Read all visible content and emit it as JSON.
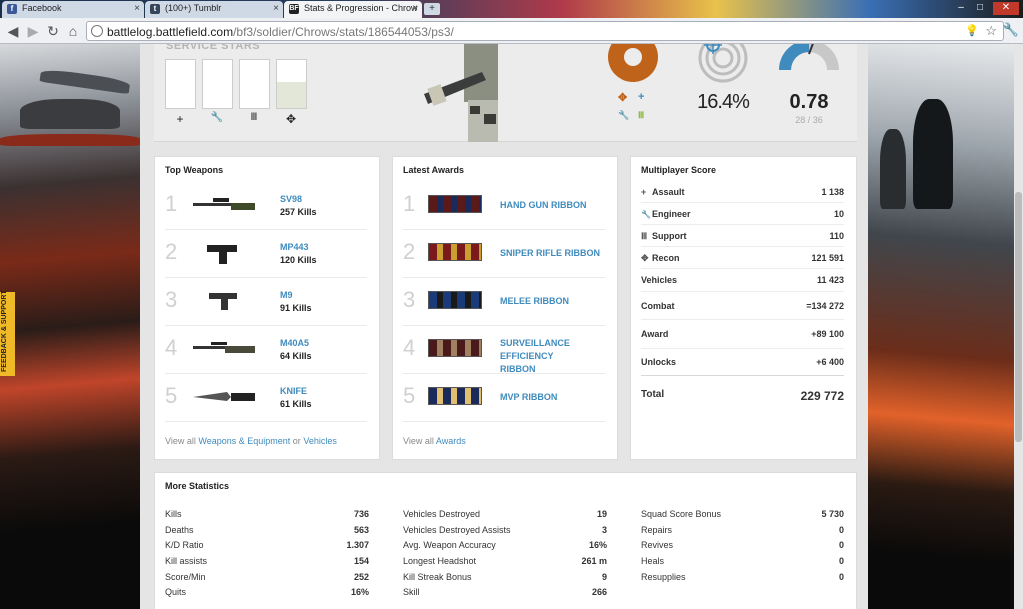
{
  "browser": {
    "tabs": [
      {
        "label": "Facebook",
        "favicon_color": "#3b5998"
      },
      {
        "label": "(100+) Tumblr",
        "favicon_color": "#35465c"
      },
      {
        "label": "Stats & Progression - Chrow",
        "favicon_color": "#222222"
      }
    ],
    "new_tab_label": "+",
    "url_host": "battlelog.battlefield.com",
    "url_path": "/bf3/soldier/Chrows/stats/186544053/ps3/"
  },
  "sidebar": {
    "feedback_label": "FEEDBACK & SUPPORT"
  },
  "service_stars": {
    "title": "SERVICE STARS",
    "icons": [
      "+",
      "🔧",
      "Ⅲ",
      "✥"
    ],
    "fill": [
      0,
      0,
      0,
      0.55
    ]
  },
  "summary": {
    "kit_icons": [
      "✥",
      "+",
      "🔧",
      "Ⅲ"
    ],
    "kit_colors": [
      "#c0631a",
      "#3f8bbd",
      "#e0a020",
      "#8ab93a"
    ],
    "accuracy": "16.4%",
    "kd": "0.78",
    "kd_sub": "28 / 36"
  },
  "top_weapons": {
    "title": "Top Weapons",
    "items": [
      {
        "rank": "1",
        "name": "SV98",
        "kills": "257 Kills"
      },
      {
        "rank": "2",
        "name": "MP443",
        "kills": "120 Kills"
      },
      {
        "rank": "3",
        "name": "M9",
        "kills": "91 Kills"
      },
      {
        "rank": "4",
        "name": "M40A5",
        "kills": "64 Kills"
      },
      {
        "rank": "5",
        "name": "KNIFE",
        "kills": "61 Kills"
      }
    ],
    "footer_prefix": "View all",
    "footer_link1": "Weapons & Equipment",
    "footer_mid": "or",
    "footer_link2": "Vehicles"
  },
  "latest_awards": {
    "title": "Latest Awards",
    "items": [
      {
        "rank": "1",
        "name": "HAND GUN RIBBON",
        "colors": [
          "#5a1a1a",
          "#1a2a5a"
        ]
      },
      {
        "rank": "2",
        "name": "SNIPER RIFLE RIBBON",
        "colors": [
          "#7a1a1a",
          "#c9a030"
        ]
      },
      {
        "rank": "3",
        "name": "MELEE RIBBON",
        "colors": [
          "#1a3a7a",
          "#1a1a1a"
        ]
      },
      {
        "rank": "4",
        "name": "SURVEILLANCE EFFICIENCY RIBBON",
        "colors": [
          "#4a1a1a",
          "#a08060"
        ]
      },
      {
        "rank": "5",
        "name": "MVP RIBBON",
        "colors": [
          "#1a2a5a",
          "#e0c070"
        ]
      }
    ],
    "footer_prefix": "View all",
    "footer_link": "Awards"
  },
  "multiplayer_score": {
    "title": "Multiplayer Score",
    "rows": [
      {
        "label": "Assault",
        "icon": "+",
        "value": "1 138"
      },
      {
        "label": "Engineer",
        "icon": "🔧",
        "value": "10"
      },
      {
        "label": "Support",
        "icon": "Ⅲ",
        "value": "110"
      },
      {
        "label": "Recon",
        "icon": "✥",
        "value": "121 591"
      },
      {
        "label": "Vehicles",
        "icon": "",
        "value": "11 423"
      },
      {
        "label": "Combat",
        "icon": "",
        "value": "=134 272"
      },
      {
        "label": "Award",
        "icon": "",
        "value": "+89 100"
      },
      {
        "label": "Unlocks",
        "icon": "",
        "value": "+6 400"
      }
    ],
    "total_label": "Total",
    "total_value": "229 772"
  },
  "more_statistics": {
    "title": "More Statistics",
    "columns": [
      [
        {
          "label": "Kills",
          "value": "736"
        },
        {
          "label": "Deaths",
          "value": "563"
        },
        {
          "label": "K/D Ratio",
          "value": "1.307"
        },
        {
          "label": "Kill assists",
          "value": "154"
        },
        {
          "label": "Score/Min",
          "value": "252"
        },
        {
          "label": "Quits",
          "value": "16%"
        }
      ],
      [
        {
          "label": "Vehicles Destroyed",
          "value": "19"
        },
        {
          "label": "Vehicles Destroyed Assists",
          "value": "3"
        },
        {
          "label": "Avg. Weapon Accuracy",
          "value": "16%"
        },
        {
          "label": "Longest Headshot",
          "value": "261 m"
        },
        {
          "label": "Kill Streak Bonus",
          "value": "9"
        },
        {
          "label": "Skill",
          "value": "266"
        }
      ],
      [
        {
          "label": "Squad Score Bonus",
          "value": "5 730"
        },
        {
          "label": "Repairs",
          "value": "0"
        },
        {
          "label": "Revives",
          "value": "0"
        },
        {
          "label": "Heals",
          "value": "0"
        },
        {
          "label": "Resupplies",
          "value": "0"
        }
      ]
    ]
  }
}
